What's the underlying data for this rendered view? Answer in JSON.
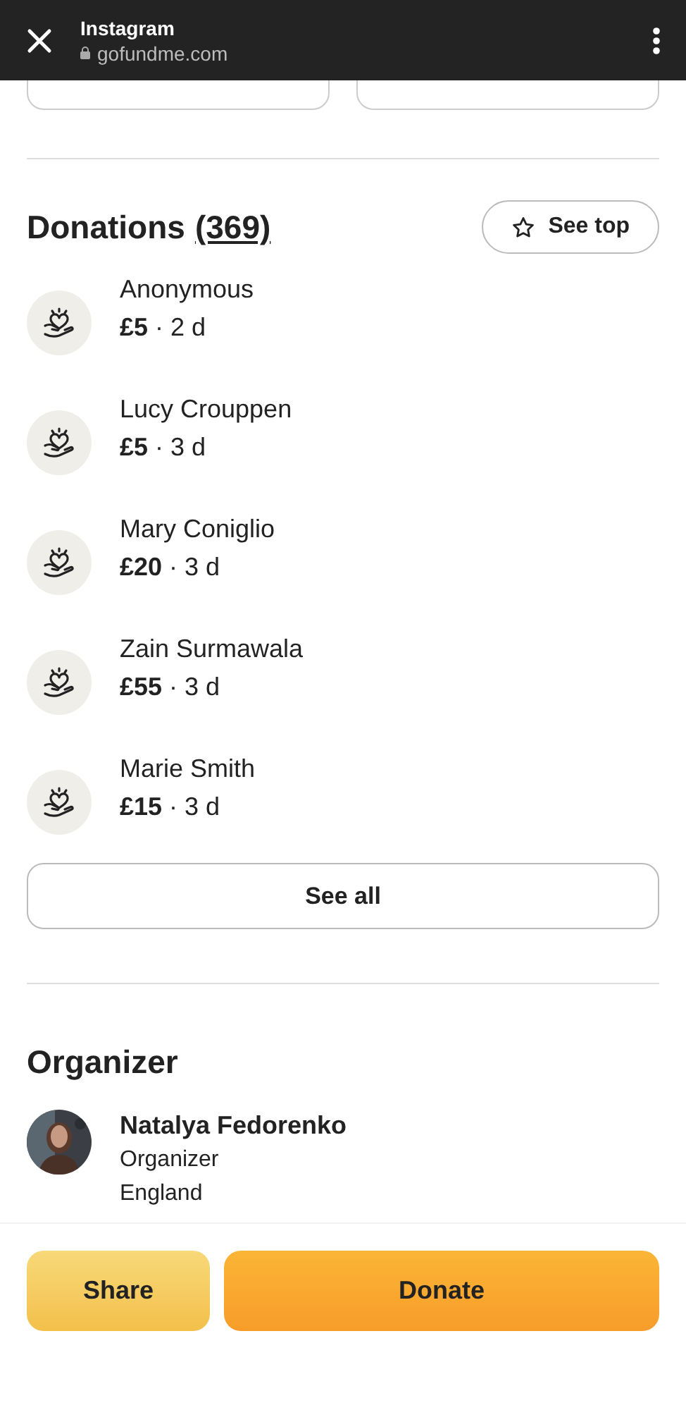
{
  "browser_bar": {
    "title": "Instagram",
    "url": "gofundme.com"
  },
  "donations": {
    "title": "Donations",
    "count": "(369)",
    "see_top": "See top",
    "items": [
      {
        "name": "Anonymous",
        "detail": "**£5** · 2 d"
      },
      {
        "name": "Lucy Crouppen",
        "detail": "**£5** · 3 d"
      },
      {
        "name": "Mary Coniglio",
        "detail": "**£20** · 3 d"
      },
      {
        "name": "Zain Surmawala",
        "detail": "**£55** · 3 d"
      },
      {
        "name": "Marie Smith",
        "detail": "**£15** · 3 d"
      }
    ],
    "see_all": "See all"
  },
  "organizer": {
    "title": "Organizer",
    "name": "Natalya Fedorenko",
    "role": "Organizer",
    "location": "England"
  },
  "actions": {
    "share": "Share",
    "donate": "Donate"
  }
}
